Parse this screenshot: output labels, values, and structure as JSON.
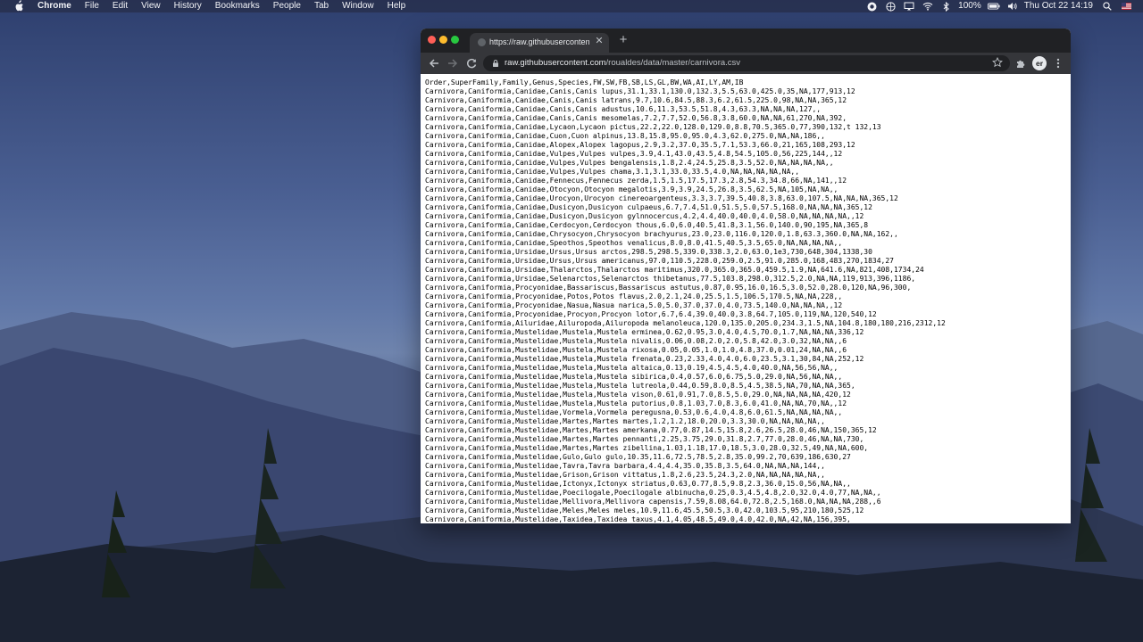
{
  "menubar": {
    "app_name": "Chrome",
    "items": [
      "File",
      "Edit",
      "View",
      "History",
      "Bookmarks",
      "People",
      "Tab",
      "Window",
      "Help"
    ],
    "battery": "100%",
    "datetime": "Thu Oct 22  14:19"
  },
  "browser": {
    "tab_title": "https://raw.githubusercontent.",
    "url_host": "raw.githubusercontent.com",
    "url_path": "/roualdes/data/master/carnivora.csv",
    "avatar_initials": "er"
  },
  "csv_lines": [
    "Order,SuperFamily,Family,Genus,Species,FW,SW,FB,SB,LS,GL,BW,WA,AI,LY,AM,IB",
    "Carnivora,Caniformia,Canidae,Canis,Canis lupus,31.1,33.1,130.0,132.3,5.5,63.0,425.0,35,NA,177,913,12",
    "Carnivora,Caniformia,Canidae,Canis,Canis latrans,9.7,10.6,84.5,88.3,6.2,61.5,225.0,98,NA,NA,365,12",
    "Carnivora,Caniformia,Canidae,Canis,Canis adustus,10.6,11.3,53.5,51.8,4.3,63.3,NA,NA,NA,127,,",
    "Carnivora,Caniformia,Canidae,Canis,Canis mesomelas,7.2,7.7,52.0,56.8,3.8,60.0,NA,NA,61,270,NA,392,",
    "Carnivora,Caniformia,Canidae,Lycaon,Lycaon pictus,22.2,22.0,128.0,129.0,8.8,70.5,365.0,77,390,132,t 132,13",
    "Carnivora,Caniformia,Canidae,Cuon,Cuon alpinus,13.8,15.8,95.0,95.0,4.3,62.0,275.0,NA,NA,186,,",
    "Carnivora,Caniformia,Canidae,Alopex,Alopex lagopus,2.9,3.2,37.0,35.5,7.1,53.3,66.0,21,165,108,293,12",
    "Carnivora,Caniformia,Canidae,Vulpes,Vulpes vulpes,3.9,4.1,43.0,43.5,4.8,54.5,105.0,56,225,144,,12",
    "Carnivora,Caniformia,Canidae,Vulpes,Vulpes bengalensis,1.8,2.4,24.5,25.8,3.5,52.0,NA,NA,NA,NA,,",
    "Carnivora,Caniformia,Canidae,Vulpes,Vulpes chama,3.1,3.1,33.0,33.5,4.0,NA,NA,NA,NA,NA,,",
    "Carnivora,Caniformia,Canidae,Fennecus,Fennecus zerda,1.5,1.5,17.5,17.3,2.8,54.3,34.8,66,NA,141,,12",
    "Carnivora,Caniformia,Canidae,Otocyon,Otocyon megalotis,3.9,3.9,24.5,26.8,3.5,62.5,NA,105,NA,NA,,",
    "Carnivora,Caniformia,Canidae,Urocyon,Urocyon cinereoargenteus,3.3,3.7,39.5,40.8,3.8,63.0,107.5,NA,NA,NA,365,12",
    "Carnivora,Caniformia,Canidae,Dusicyon,Dusicyon culpaeus,6.7,7.4,51.0,51.5,5.0,57.5,168.0,NA,NA,NA,365,12",
    "Carnivora,Caniformia,Canidae,Dusicyon,Dusicyon gylnnocercus,4.2,4.4,40.0,40.0,4.0,58.0,NA,NA,NA,NA,,12",
    "Carnivora,Caniformia,Canidae,Cerdocyon,Cerdocyon thous,6.0,6.0,40.5,41.8,3.1,56.0,140.0,90,195,NA,365,8",
    "Carnivora,Caniformia,Canidae,Chrysocyon,Chrysocyon brachyurus,23.0,23.0,116.0,120.0,1.8,63.3,360.0,NA,NA,162,,",
    "Carnivora,Caniformia,Canidae,Speothos,Speothos venalicus,8.0,8.0,41.5,40.5,3.5,65.0,NA,NA,NA,NA,,",
    "Carnivora,Caniformia,Ursidae,Ursus,Ursus arctos,298.5,298.5,339.0,338.3,2.0,63.0,1e3,730,648,304,1338,30",
    "Carnivora,Caniformia,Ursidae,Ursus,Ursus americanus,97.0,110.5,228.0,259.0,2.5,91.0,285.0,168,483,270,1834,27",
    "Carnivora,Caniformia,Ursidae,Thalarctos,Thalarctos maritimus,320.0,365.0,365.0,459.5,1.9,NA,641.6,NA,821,408,1734,24",
    "Carnivora,Caniformia,Ursidae,Selenarctos,Selenarctos thibetanus,77.5,103.8,298.0,312.5,2.0,NA,NA,119,913,396,1186,",
    "Carnivora,Caniformia,Procyonidae,Bassariscus,Bassariscus astutus,0.87,0.95,16.0,16.5,3.0,52.0,28.0,120,NA,96,300,",
    "Carnivora,Caniformia,Procyonidae,Potos,Potos flavus,2.0,2.1,24.0,25.5,1.5,106.5,170.5,NA,NA,228,,",
    "Carnivora,Caniformia,Procyonidae,Nasua,Nasua narica,5.0,5.0,37.0,37.0,4.0,73.5,140.0,NA,NA,NA,,12",
    "Carnivora,Caniformia,Procyonidae,Procyon,Procyon lotor,6.7,6.4,39.0,40.0,3.8,64.7,105.0,119,NA,120,540,12",
    "Carnivora,Caniformia,Ailuridae,Ailuropoda,Ailuropoda melanoleuca,120.0,135.0,205.0,234.3,1.5,NA,104.8,180,180,216,2312,12",
    "Carnivora,Caniformia,Mustelidae,Mustela,Mustela erminea,0.62,0.95,3.0,4.0,4.5,70.0,1.7,NA,NA,NA,336,12",
    "Carnivora,Caniformia,Mustelidae,Mustela,Mustela nivalis,0.06,0.08,2.0,2.0,5.8,42.0,3.0,32,NA,NA,,6",
    "Carnivora,Caniformia,Mustelidae,Mustela,Mustela rixosa,0.05,0.05,1.0,1.0,4.8,37.0,0.01,24,NA,NA,,6",
    "Carnivora,Caniformia,Mustelidae,Mustela,Mustela frenata,0.23,2.33,4.0,4.0,6.0,23.5,3.1,30,84,NA,252,12",
    "Carnivora,Caniformia,Mustelidae,Mustela,Mustela altaica,0.13,0.19,4.5,4.5,4.0,40.0,NA,56,56,NA,,",
    "Carnivora,Caniformia,Mustelidae,Mustela,Mustela sibirica,0.4,0.57,6.0,6.75,5.0,29.0,NA,56,NA,NA,,",
    "Carnivora,Caniformia,Mustelidae,Mustela,Mustela lutreola,0.44,0.59,8.0,8.5,4.5,38.5,NA,70,NA,NA,365,",
    "Carnivora,Caniformia,Mustelidae,Mustela,Mustela vison,0.61,0.91,7.0,8.5,5.0,29.0,NA,NA,NA,NA,420,12",
    "Carnivora,Caniformia,Mustelidae,Mustela,Mustela putorius,0.8,1.03,7.0,8.3,6.0,41.0,NA,NA,70,NA,,12",
    "Carnivora,Caniformia,Mustelidae,Vormela,Vormela peregusna,0.53,0.6,4.0,4.8,6.0,61.5,NA,NA,NA,NA,,",
    "Carnivora,Caniformia,Mustelidae,Martes,Martes martes,1.2,1.2,18.0,20.0,3.3,30.0,NA,NA,NA,NA,,",
    "Carnivora,Caniformia,Mustelidae,Martes,Martes amerkana,0.77,0.87,14.5,15.8,2.6,26.5,28.0,46,NA,150,365,12",
    "Carnivora,Caniformia,Mustelidae,Martes,Martes pennanti,2.25,3.75,29.0,31.8,2.7,77.0,28.0,46,NA,NA,730,",
    "Carnivora,Caniformia,Mustelidae,Martes,Martes zibellina,1.03,1.18,17.0,18.5,3.0,28.0,32.5,49,NA,NA,600,",
    "Carnivora,Caniformia,Mustelidae,Gulo,Gulo gulo,10.35,11.6,72.5,78.5,2.8,35.0,99.2,70,639,186,630,27",
    "Carnivora,Caniformia,Mustelidae,Tavra,Tavra barbara,4.4,4.4,35.0,35.8,3.5,64.0,NA,NA,NA,144,,",
    "Carnivora,Caniformia,Mustelidae,Grison,Grison vittatus,1.8,2.6,23.5,24.3,2.0,NA,NA,NA,NA,NA,,",
    "Carnivora,Caniformia,Mustelidae,Ictonyx,Ictonyx striatus,0.63,0.77,8.5,9.8,2.3,36.0,15.0,56,NA,NA,,",
    "Carnivora,Caniformia,Mustelidae,Poecilogale,Poecilogale albinucha,0.25,0.3,4.5,4.8,2.0,32.0,4.0,77,NA,NA,,",
    "Carnivora,Caniformia,Mustelidae,Mellivora,Mellivora capensis,7.59,8.08,64.0,72.8,2.5,168.0,NA,NA,NA,288,,6",
    "Carnivora,Caniformia,Mustelidae,Meles,Meles meles,10.9,11.6,45.5,50.5,3.0,42.0,103.5,95,210,180,525,12",
    "Carnivora,Caniformia,Mustelidae,Taxidea,Taxidea taxus,4.1,4.05,48.5,49.0,4.0,42.0,NA,42,NA,156,395,"
  ]
}
